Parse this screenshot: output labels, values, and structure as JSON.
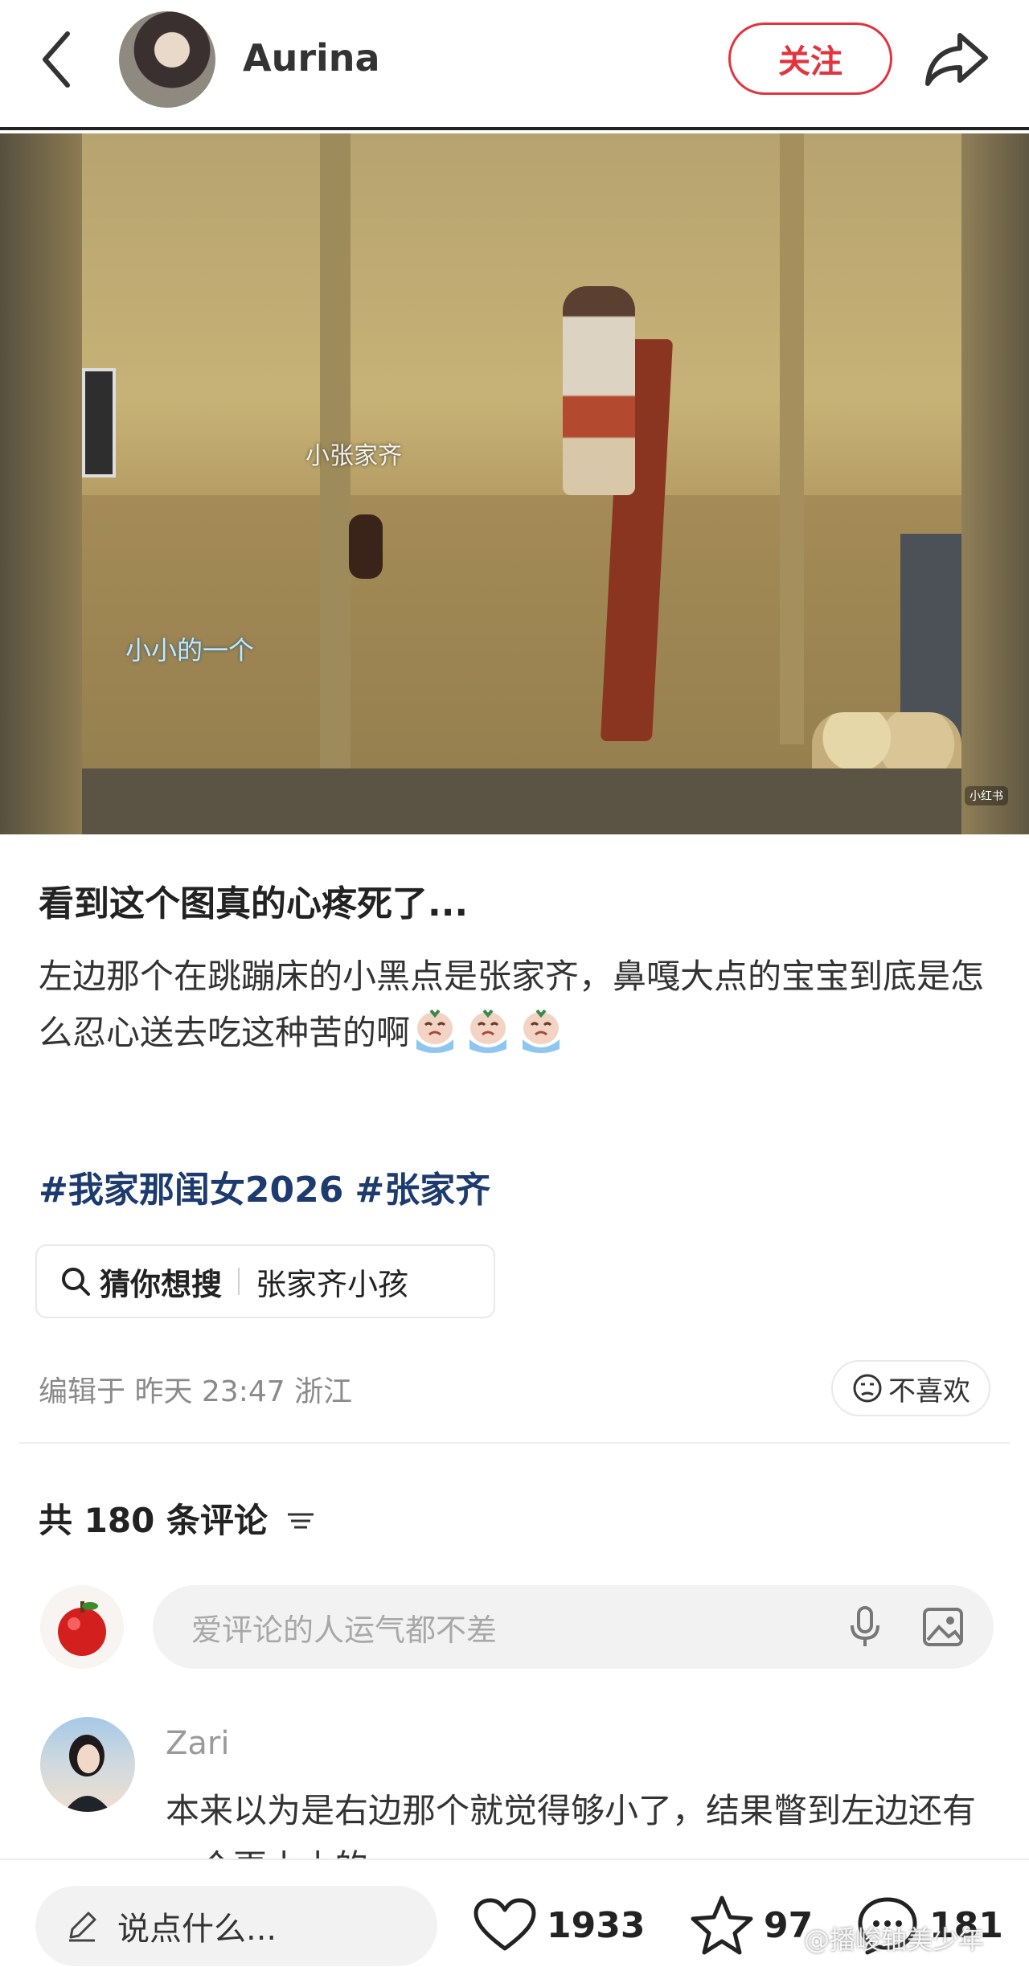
{
  "header": {
    "author": "Aurina",
    "follow_label": "关注"
  },
  "media": {
    "caption_top": "小张家齐",
    "caption_bottom": "小小的一个",
    "watermark": "小红书"
  },
  "post": {
    "title": "看到这个图真的心疼死了...",
    "body": "左边那个在跳蹦床的小黑点是张家齐，鼻嘎大点的宝宝到底是怎么忍心送去吃这种苦的啊",
    "hashtags": [
      "#我家那闺女2026",
      "#张家齐"
    ],
    "search_label": "猜你想搜",
    "search_query": "张家齐小孩",
    "meta": "编辑于 昨天 23:47 浙江",
    "dislike_label": "不喜欢"
  },
  "comments": {
    "count_label": "共 180 条评论",
    "input_placeholder": "爱评论的人运气都不差",
    "first": {
      "user": "Zari",
      "text": "本来以为是右边那个就觉得够小了，结果瞥到左边还有一个更小小的"
    }
  },
  "bottom_bar": {
    "say_placeholder": "说点什么...",
    "likes": "1933",
    "favorites": "97",
    "comments": "181",
    "watermark": "@播峻轴美少年"
  },
  "colors": {
    "accent": "#e2343f",
    "hashtag": "#1d3b6e"
  },
  "icons": [
    "back-icon",
    "share-icon",
    "search-icon",
    "dislike-face-icon",
    "filter-icon",
    "mic-icon",
    "image-icon",
    "pencil-icon",
    "heart-icon",
    "star-icon",
    "comment-icon",
    "crying-emoji-icon"
  ]
}
